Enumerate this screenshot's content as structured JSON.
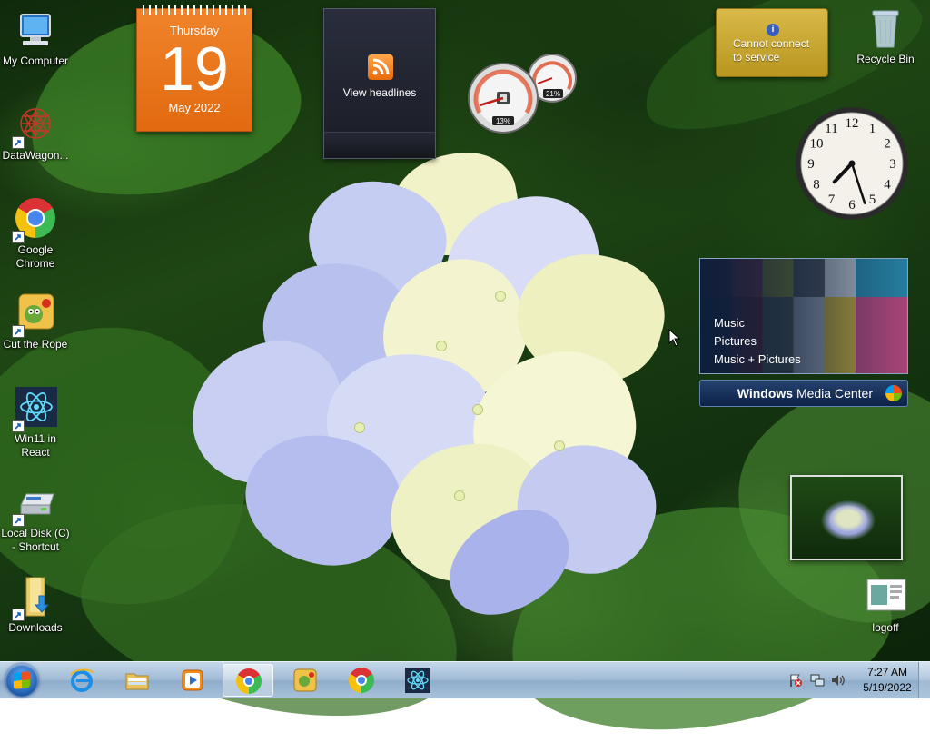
{
  "desktop": {
    "icons": [
      {
        "label": "My Computer"
      },
      {
        "label": "DataWagon..."
      },
      {
        "label": "Google Chrome"
      },
      {
        "label": "Cut the Rope"
      },
      {
        "label": "Win11 in React"
      },
      {
        "label": "Local Disk (C) - Shortcut"
      },
      {
        "label": "Downloads"
      },
      {
        "label": "Recycle Bin"
      },
      {
        "label": "logoff"
      }
    ]
  },
  "gadgets": {
    "calendar": {
      "weekday": "Thursday",
      "day": "19",
      "month_year": "May 2022"
    },
    "feed": {
      "caption": "View headlines"
    },
    "cpu_meter": {
      "cpu_percent": "13%",
      "memory_percent": "21%"
    },
    "weather": {
      "message": "Cannot connect to service"
    },
    "clock": {
      "hour": 7,
      "minute": 27
    },
    "media_center": {
      "menu": [
        "Music",
        "Pictures",
        "Music + Pictures"
      ],
      "brand_bold": "Windows",
      "brand_rest": " Media Center"
    }
  },
  "taskbar": {
    "apps": [
      {
        "name": "Internet Explorer"
      },
      {
        "name": "File Explorer"
      },
      {
        "name": "Media Player"
      },
      {
        "name": "Google Chrome",
        "active": true
      },
      {
        "name": "Cut the Rope"
      },
      {
        "name": "Google Chrome"
      },
      {
        "name": "Win11 in React"
      }
    ],
    "clock": {
      "time": "7:27 AM",
      "date": "5/19/2022"
    }
  },
  "colors": {
    "calendar_orange": "#e8761a",
    "taskbar_blue": "#9fbad4",
    "weather_gold": "#c9a633"
  }
}
